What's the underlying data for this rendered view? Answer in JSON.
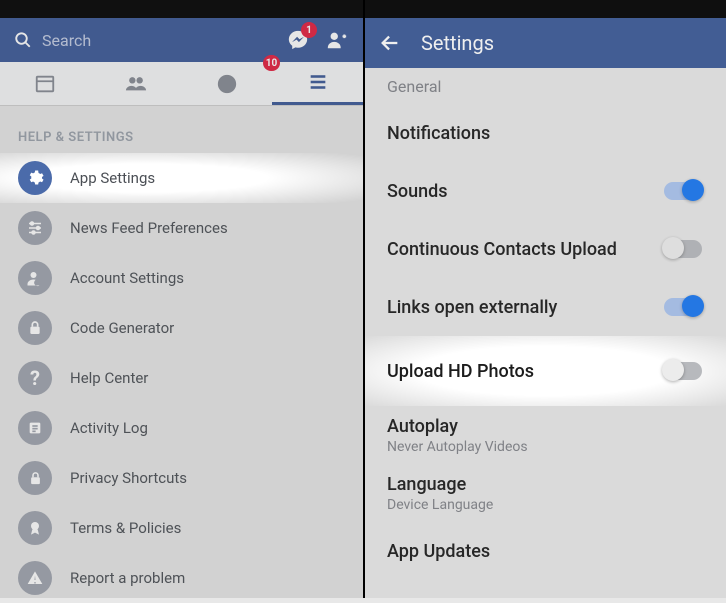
{
  "left": {
    "search_placeholder": "Search",
    "messenger_badge": "1",
    "notif_badge": "10",
    "section_title": "HELP & SETTINGS",
    "items": [
      {
        "label": "App Settings"
      },
      {
        "label": "News Feed Preferences"
      },
      {
        "label": "Account Settings"
      },
      {
        "label": "Code Generator"
      },
      {
        "label": "Help Center"
      },
      {
        "label": "Activity Log"
      },
      {
        "label": "Privacy Shortcuts"
      },
      {
        "label": "Terms & Policies"
      },
      {
        "label": "Report a problem"
      }
    ]
  },
  "right": {
    "title": "Settings",
    "rows": {
      "general": "General",
      "notifications": "Notifications",
      "sounds": "Sounds",
      "contacts": "Continuous Contacts Upload",
      "links": "Links open externally",
      "hd": "Upload HD Photos",
      "autoplay": "Autoplay",
      "autoplay_sub": "Never Autoplay Videos",
      "language": "Language",
      "language_sub": "Device Language",
      "updates": "App Updates"
    }
  }
}
